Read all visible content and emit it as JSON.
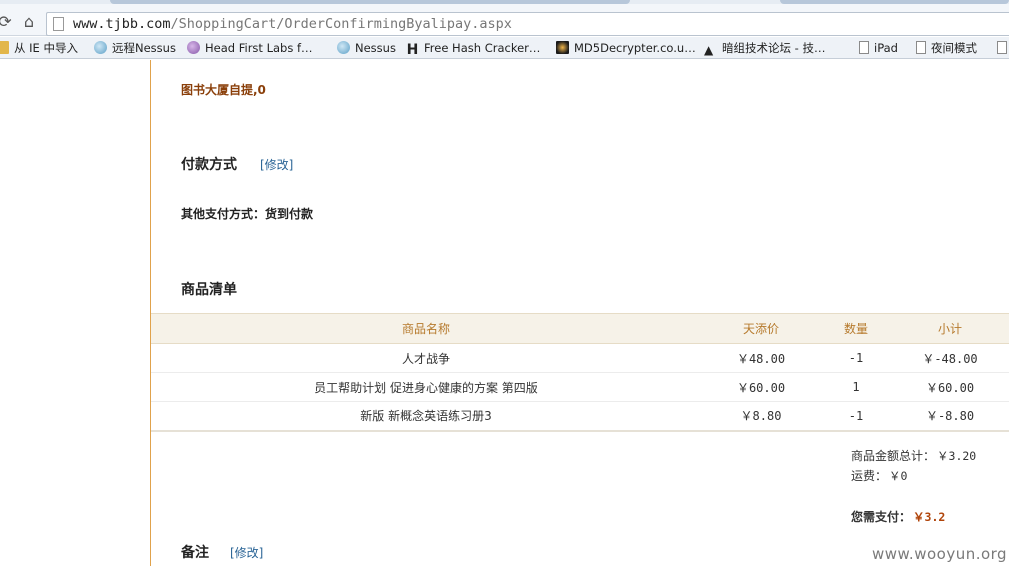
{
  "browser": {
    "url_host": "www.tjbb.com",
    "url_path": "/ShoppingCart/OrderConfirmingByalipay.aspx",
    "bookmarks": [
      {
        "label": "从 IE 中导入",
        "icon": "folder-icon"
      },
      {
        "label": "远程Nessus",
        "icon": "globe-icon"
      },
      {
        "label": "Head First Labs f…",
        "icon": "brain-icon"
      },
      {
        "label": "Nessus",
        "icon": "globe-icon"
      },
      {
        "label": "Free Hash Cracker…",
        "icon": "hash-icon"
      },
      {
        "label": "MD5Decrypter.co.u…",
        "icon": "site-icon"
      },
      {
        "label": "暗组技术论坛 - 技…",
        "icon": "hat-icon"
      },
      {
        "label": "iPad",
        "icon": "page-icon"
      },
      {
        "label": "夜间模式",
        "icon": "page-icon"
      }
    ]
  },
  "order": {
    "pickup_text": "图书大厦自提,0",
    "payment": {
      "title": "付款方式",
      "edit_label": "[修改]",
      "method_text": "其他支付方式：货到付款"
    },
    "items_section": {
      "title": "商品清单",
      "headers": {
        "name": "商品名称",
        "price": "天添价",
        "qty": "数量",
        "subtotal": "小计"
      },
      "rows": [
        {
          "name": "人才战争",
          "price": "￥48.00",
          "qty": "-1",
          "subtotal": "￥-48.00"
        },
        {
          "name": "员工帮助计划 促进身心健康的方案 第四版",
          "price": "￥60.00",
          "qty": "1",
          "subtotal": "￥60.00"
        },
        {
          "name": "新版 新概念英语练习册3",
          "price": "￥8.80",
          "qty": "-1",
          "subtotal": "￥-8.80"
        }
      ]
    },
    "summary": {
      "goods_total_label": "商品金额总计：",
      "goods_total_value": "￥3.20",
      "shipping_label": "运费：",
      "shipping_value": "￥0",
      "pay_label": "您需支付：",
      "pay_value": "￥3.2"
    },
    "remarks": {
      "title": "备注",
      "edit_label": "[修改]"
    }
  },
  "watermark": "www.wooyun.org"
}
